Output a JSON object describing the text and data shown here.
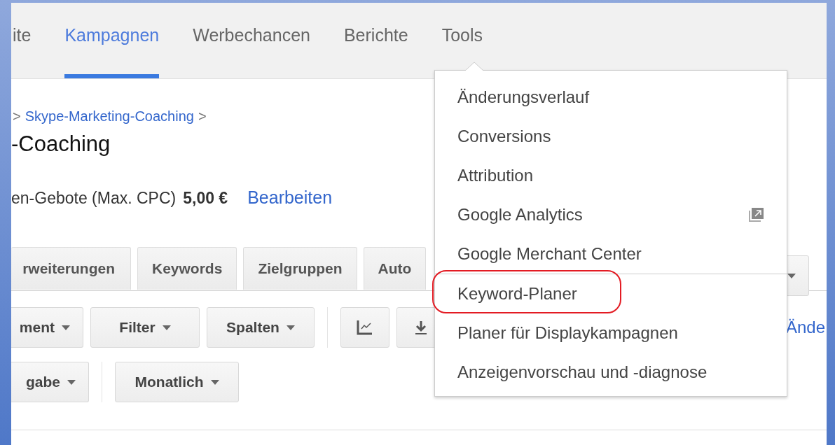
{
  "nav": {
    "tabs": [
      {
        "label": "ite",
        "selected": false
      },
      {
        "label": "Kampagnen",
        "selected": true
      },
      {
        "label": "Werbechancen",
        "selected": false
      },
      {
        "label": "Berichte",
        "selected": false
      },
      {
        "label": "Tools",
        "selected": false
      }
    ]
  },
  "breadcrumb": {
    "separator_before": ">",
    "link": "Skype-Marketing-Coaching",
    "separator_after": ">"
  },
  "title": "-Coaching",
  "bid": {
    "label": "en-Gebote (Max. CPC)",
    "value": "5,00 €",
    "link": "Bearbeiten"
  },
  "view_tabs": [
    {
      "label": "rweiterungen"
    },
    {
      "label": "Keywords"
    },
    {
      "label": "Zielgruppen"
    },
    {
      "label": "Auto"
    }
  ],
  "toolbar": [
    {
      "kind": "dropdown",
      "label": "ment"
    },
    {
      "kind": "dropdown",
      "label": "Filter"
    },
    {
      "kind": "dropdown",
      "label": "Spalten"
    },
    {
      "kind": "separator"
    },
    {
      "kind": "chart"
    },
    {
      "kind": "download"
    }
  ],
  "toolbar_link": "Ände",
  "period_bar": [
    {
      "kind": "dropdown",
      "label": "gabe"
    },
    {
      "kind": "separator"
    },
    {
      "kind": "dropdown",
      "label": "Monatlich"
    }
  ],
  "tools_menu": {
    "items": [
      {
        "label": "Änderungsverlauf",
        "external": false,
        "highlighted": false,
        "divider_before": false
      },
      {
        "label": "Conversions",
        "external": false,
        "highlighted": false,
        "divider_before": false
      },
      {
        "label": "Attribution",
        "external": false,
        "highlighted": false,
        "divider_before": false
      },
      {
        "label": "Google Analytics",
        "external": true,
        "highlighted": false,
        "divider_before": false
      },
      {
        "label": "Google Merchant Center",
        "external": false,
        "highlighted": false,
        "divider_before": false
      },
      {
        "label": "Keyword-Planer",
        "external": false,
        "highlighted": true,
        "divider_before": true
      },
      {
        "label": "Planer für Displaykampagnen",
        "external": false,
        "highlighted": false,
        "divider_before": false
      },
      {
        "label": "Anzeigenvorschau und -diagnose",
        "external": false,
        "highlighted": false,
        "divider_before": false
      }
    ]
  }
}
